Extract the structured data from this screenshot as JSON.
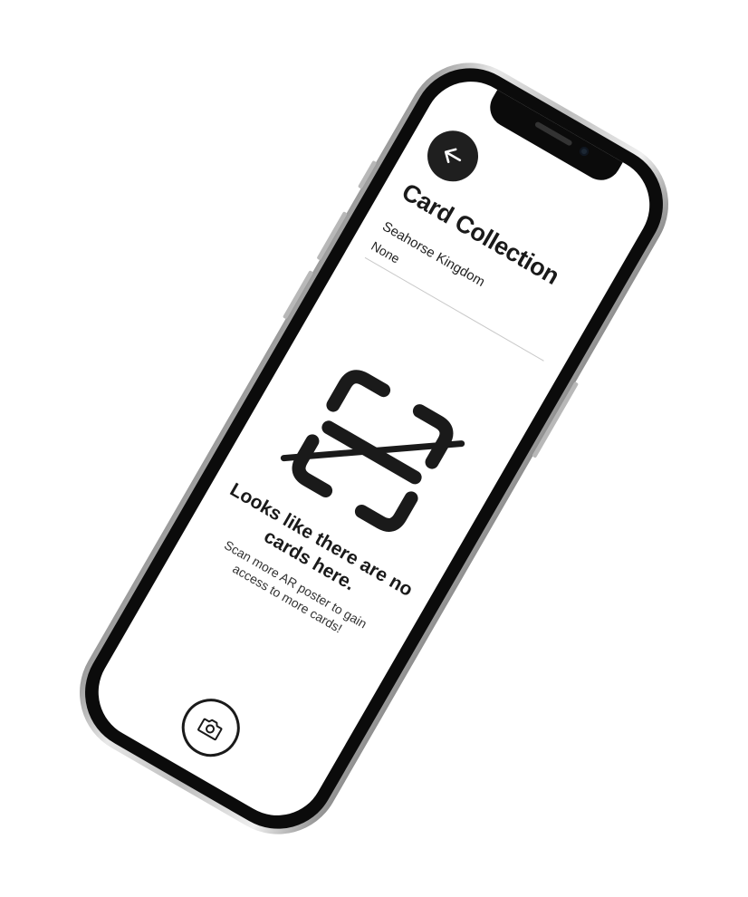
{
  "header": {
    "title": "Card Collection",
    "back_icon": "arrow-left-icon"
  },
  "collection": {
    "name": "Seahorse Kingdom",
    "value": "None"
  },
  "empty_state": {
    "icon": "scan-frame-slashed-icon",
    "title": "Looks like there are no cards here.",
    "subtitle": "Scan more AR poster to gain access to more cards!"
  },
  "footer": {
    "camera_icon": "camera-icon"
  },
  "colors": {
    "ink": "#1a1a1a",
    "screen_bg": "#ffffff",
    "divider": "#c9c9c9"
  }
}
